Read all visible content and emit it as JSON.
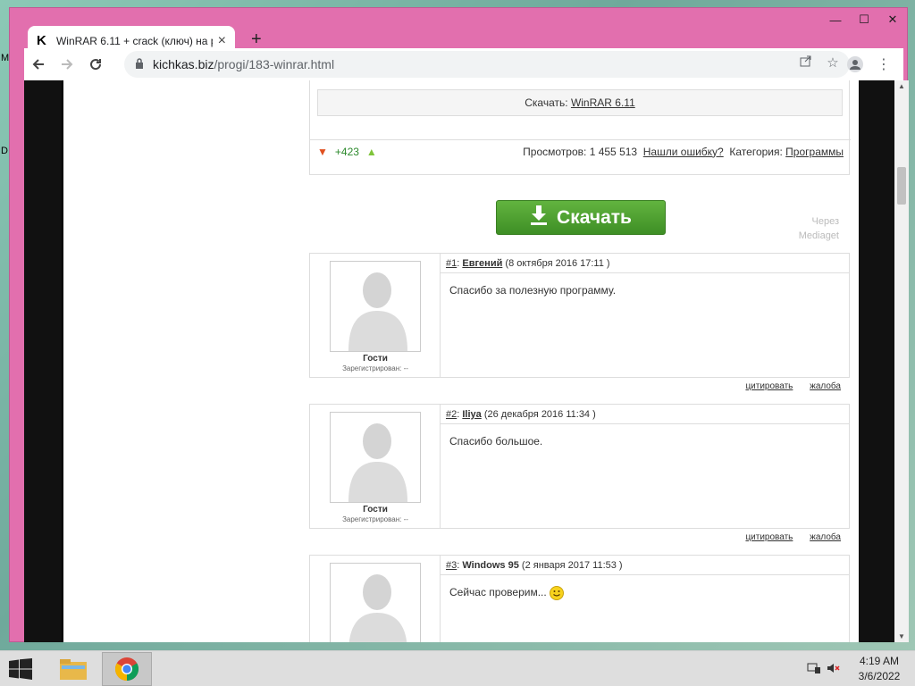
{
  "desktop": {
    "side_letters": [
      "M",
      "D"
    ]
  },
  "window": {
    "controls": {
      "minimize": "—",
      "maximize": "☐",
      "close": "✕"
    }
  },
  "browser": {
    "tab": {
      "favicon": "K",
      "title": "WinRAR 6.11 + crack (ключ) на р",
      "close": "×"
    },
    "new_tab": "+",
    "url": {
      "domain": "kichkas.biz",
      "path": "/progi/183-winrar.html"
    }
  },
  "page": {
    "download_line": {
      "prefix": "Скачать:",
      "link": "WinRAR 6.11"
    },
    "stats": {
      "rating": "+423",
      "views_label": "Просмотров:",
      "views": "1 455 513",
      "report_link": "Нашли ошибку?",
      "category_label": "Категория:",
      "category_link": "Программы"
    },
    "download_button": "Скачать",
    "via": [
      "Через",
      "Mediaget"
    ],
    "comments": [
      {
        "num": "#1",
        "author": "Евгений",
        "date": "(8 октября 2016 17:11 )",
        "text": "Спасибо за полезную программу.",
        "group": "Гости",
        "registered": "Зарегистрирован: --",
        "quote": "цитировать",
        "complain": "жалоба"
      },
      {
        "num": "#2",
        "author": "Iliya",
        "date": "(26 декабря 2016 11:34 )",
        "text": "Спасибо большое.",
        "group": "Гости",
        "registered": "Зарегистрирован: --",
        "quote": "цитировать",
        "complain": "жалоба"
      },
      {
        "num": "#3",
        "author": "Windows 95",
        "date": "(2 января 2017 11:53 )",
        "text": "Сейчас проверим...",
        "group": "",
        "registered": "",
        "quote": "",
        "complain": ""
      }
    ]
  },
  "taskbar": {
    "clock": {
      "time": "4:19 AM",
      "date": "3/6/2022"
    }
  },
  "colors": {
    "window_frame": "#e26fae",
    "download_button": "#4fa232",
    "rating_green": "#2d8a2d"
  }
}
